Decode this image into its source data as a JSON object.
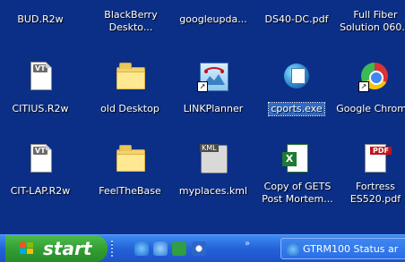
{
  "desktop": {
    "icons": [
      {
        "label": "BUD.R2w"
      },
      {
        "label": "BlackBerry Deskto..."
      },
      {
        "label": "googleupda..."
      },
      {
        "label": "DS40-DC.pdf"
      },
      {
        "label": "Full Fiber Solution 060..."
      },
      {
        "label": "CITIUS.R2w"
      },
      {
        "label": "old Desktop"
      },
      {
        "label": "LINKPlanner"
      },
      {
        "label": "cports.exe"
      },
      {
        "label": "Google Chrome"
      },
      {
        "label": "CIT-LAP.R2w"
      },
      {
        "label": "FeelTheBase"
      },
      {
        "label": "myplaces.kml"
      },
      {
        "label": "Copy of GETS Post Mortem..."
      },
      {
        "label": "Fortress ES520.pdf"
      }
    ],
    "file_badge": "VT",
    "kml_badge": "KML",
    "pdf_badge": "PDF"
  },
  "taskbar": {
    "start_label": "start",
    "more_glyph": "»",
    "window_button": "GTRM100 Status ar"
  }
}
